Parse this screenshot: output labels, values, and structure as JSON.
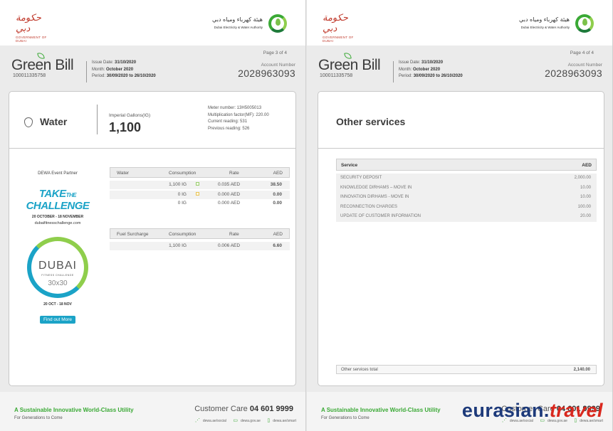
{
  "header": {
    "gov_logo_script": "حكومة دبي",
    "gov_caption": "GOVERNMENT OF DUBAI",
    "dewa_arabic": "هيئة كهرباء ومياه دبي",
    "dewa_english": "Dubai Electricity & Water Authority"
  },
  "bill_header": {
    "brand": "Green Bill",
    "bill_id": "100011335758",
    "issue_date_label": "Issue Date:",
    "issue_date": "31/10/2020",
    "month_label": "Month:",
    "month": "October 2020",
    "period_label": "Period:",
    "period": "30/09/2020 to 26/10/2020",
    "account_label": "Account Number",
    "account_number": "2028963093"
  },
  "page_left": {
    "page_number": "Page 3 of 4",
    "service_title": "Water",
    "ig_label": "Imperial Gallons(IG)",
    "ig_value": "1,100",
    "meter": {
      "meter_number": "Meter number: 13H5005013",
      "multiplication_factor": "Multiplication factor(MF): 220.00",
      "current_reading": "Current reading: 531",
      "previous_reading": "Previous reading: 526"
    },
    "partner": {
      "label": "DEWA Event Partner",
      "take": "TAKE",
      "the": "THE",
      "challenge": "CHALLENGE",
      "dates": "20 OCTOBER - 18 NOVEMBER",
      "url": "dubaifitnesschallenge.com",
      "dfc_title": "DUBAI",
      "dfc_sub": "FITNESS CHALLENGE",
      "dfc_30": "30x30",
      "dfc_dates": "20 OCT - 18 NOV",
      "button": "Find out More"
    },
    "water_table": {
      "headers": [
        "Water",
        "Consumption",
        "Rate",
        "AED"
      ],
      "rows": [
        {
          "consumption": "1,100 IG",
          "rate": "0.035 AED",
          "aed": "38.50",
          "tier": "green"
        },
        {
          "consumption": "0 IG",
          "rate": "0.000 AED",
          "aed": "0.00",
          "tier": "amber"
        },
        {
          "consumption": "0 IG",
          "rate": "0.000 AED",
          "aed": "0.00",
          "tier": "none"
        }
      ]
    },
    "fuel_table": {
      "headers": [
        "Fuel Surcharge",
        "Consumption",
        "Rate",
        "AED"
      ],
      "rows": [
        {
          "consumption": "1,100 IG",
          "rate": "0.006 AED",
          "aed": "6.60"
        }
      ]
    }
  },
  "page_right": {
    "page_number": "Page 4 of 4",
    "title": "Other services",
    "table_headers": [
      "Service",
      "AED"
    ],
    "rows": [
      {
        "service": "SECURITY DEPOSIT",
        "aed": "2,000.00"
      },
      {
        "service": "KNOWLEDGE DIRHAMS – MOVE IN",
        "aed": "10.00"
      },
      {
        "service": "INNOVATION DIRHAMS - MOVE IN",
        "aed": "10.00"
      },
      {
        "service": "RECONNECTION CHARGES",
        "aed": "100.00"
      },
      {
        "service": "UPDATE OF CUSTOMER INFORMATION",
        "aed": "20.00"
      }
    ],
    "total_label": "Other services total",
    "total_value": "2,140.00"
  },
  "footer": {
    "tagline": "A Sustainable Innovative World-Class Utility",
    "subline": "For Generations to Come",
    "customer_care_label": "Customer Care",
    "customer_care_number": "04 601 9999",
    "links": [
      "dewa.ae/social",
      "dewa.gov.ae",
      "dewa.ae/smart"
    ],
    "link_icons": [
      "share-icon",
      "monitor-icon",
      "phone-icon"
    ]
  },
  "watermark": {
    "part1": "eurasian.",
    "part2": "travel"
  },
  "colors": {
    "green": "#3aa935",
    "blue": "#1ba3c7",
    "watermark_blue": "#1d3a7a",
    "watermark_red": "#d9281e"
  }
}
